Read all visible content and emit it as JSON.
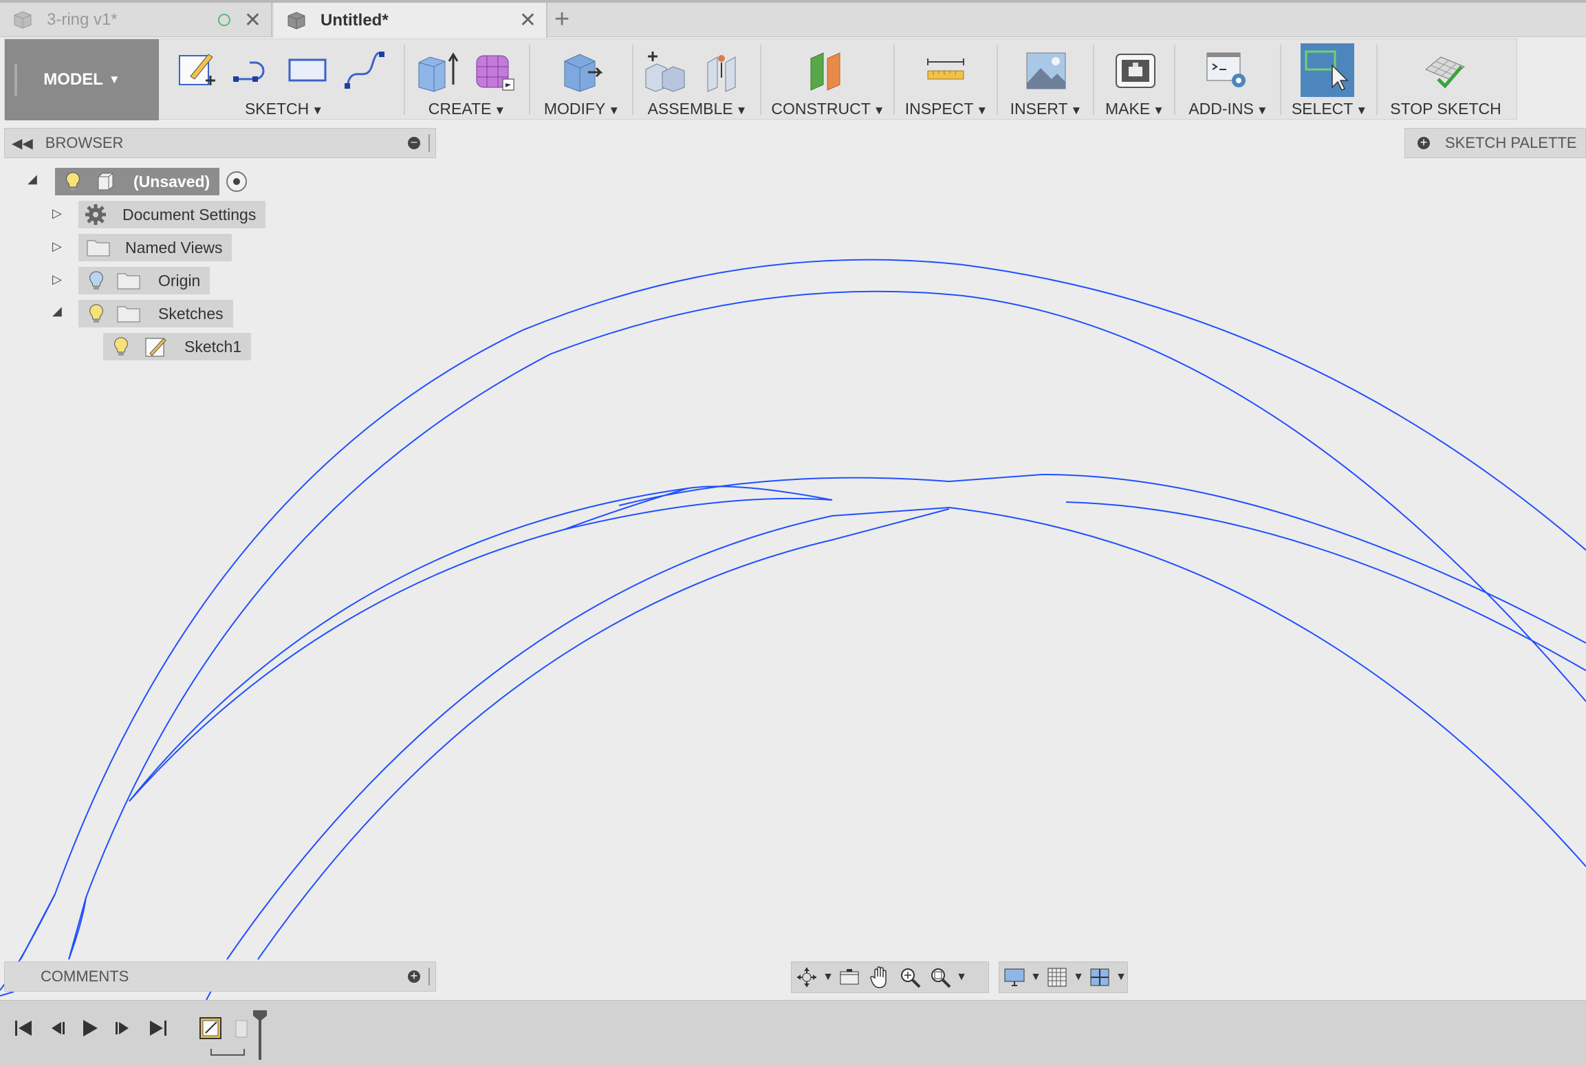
{
  "tabs": [
    {
      "title": "3-ring v1*",
      "active": false,
      "unsaved_indicator": true
    },
    {
      "title": "Untitled*",
      "active": true
    }
  ],
  "toolbar": {
    "workspace": "MODEL",
    "groups": [
      {
        "label": "SKETCH",
        "has_menu": true
      },
      {
        "label": "CREATE",
        "has_menu": true
      },
      {
        "label": "MODIFY",
        "has_menu": true
      },
      {
        "label": "ASSEMBLE",
        "has_menu": true
      },
      {
        "label": "CONSTRUCT",
        "has_menu": true
      },
      {
        "label": "INSPECT",
        "has_menu": true
      },
      {
        "label": "INSERT",
        "has_menu": true
      },
      {
        "label": "MAKE",
        "has_menu": true
      },
      {
        "label": "ADD-INS",
        "has_menu": true
      },
      {
        "label": "SELECT",
        "has_menu": true
      },
      {
        "label": "STOP SKETCH",
        "has_menu": false
      }
    ]
  },
  "browser": {
    "title": "BROWSER",
    "tree": [
      {
        "label": "(Unsaved)",
        "icon": "component-icon"
      },
      {
        "label": "Document Settings",
        "icon": "gear-icon"
      },
      {
        "label": "Named Views",
        "icon": "folder-icon"
      },
      {
        "label": "Origin",
        "icon": "folder-icon"
      },
      {
        "label": "Sketches",
        "icon": "folder-icon"
      },
      {
        "label": "Sketch1",
        "icon": "sketch-icon"
      }
    ]
  },
  "sketch_palette": {
    "title": "SKETCH PALETTE"
  },
  "comments": {
    "title": "COMMENTS"
  },
  "colors": {
    "sketch_line": "#1f4fff",
    "select_active": "#4d86bd",
    "background": "#ececec"
  }
}
